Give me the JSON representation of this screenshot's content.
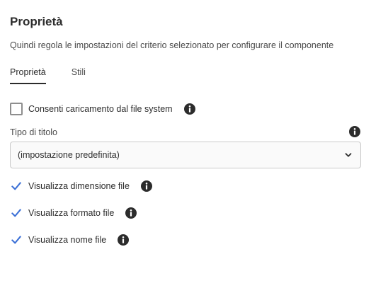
{
  "panel": {
    "title": "Proprietà",
    "subtitle": "Quindi regola le impostazioni del criterio selezionato per configurare il componente"
  },
  "tabs": [
    {
      "label": "Proprietà",
      "selected": true
    },
    {
      "label": "Stili",
      "selected": false
    }
  ],
  "options": {
    "allow_upload": {
      "label": "Consenti caricamento dal file system",
      "checked": false
    },
    "title_type": {
      "label": "Tipo di titolo",
      "value": "(impostazione predefinita)"
    },
    "show_size": {
      "label": "Visualizza dimensione file",
      "checked": true
    },
    "show_format": {
      "label": "Visualizza formato file",
      "checked": true
    },
    "show_name": {
      "label": "Visualizza nome file",
      "checked": true
    }
  },
  "icons": {
    "info": "info-icon",
    "dropdown": "chevron-down-icon",
    "check": "checkmark-icon"
  },
  "colors": {
    "check_accent": "#3a6fd6",
    "icon_dark": "#2c2c2c",
    "tab_underline": "#2c2c2c"
  }
}
